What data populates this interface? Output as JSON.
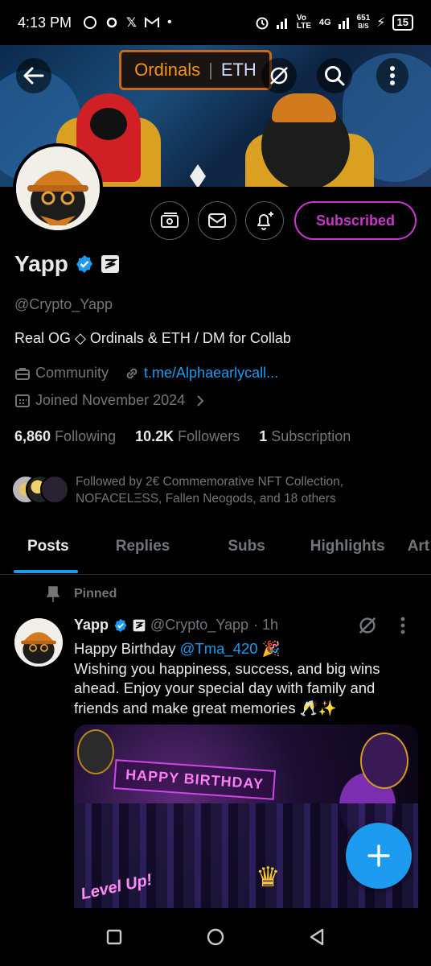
{
  "status_bar": {
    "time": "4:13 PM",
    "network": "Vo LTE",
    "network2": "4G",
    "speed": "651",
    "speed_unit": "B/S",
    "battery": "15"
  },
  "banner": {
    "sign_left": "Ordinals",
    "sign_right": "ETH"
  },
  "profile": {
    "name": "Yapp",
    "handle": "@Crypto_Yapp",
    "bio": "Real OG ◇ Ordinals & ETH / DM for Collab",
    "category": "Community",
    "link": "t.me/Alphaearlycall...",
    "joined": "Joined November 2024",
    "subscribed_label": "Subscribed"
  },
  "stats": {
    "following_count": "6,860",
    "following_label": "Following",
    "followers_count": "10.2K",
    "followers_label": "Followers",
    "subscriptions_count": "1",
    "subscriptions_label": "Subscription"
  },
  "followed_by": "Followed by 2€ Commemorative NFT Collection, NOFACELΞSS, Fallen Neogods, and 18 others",
  "tabs": [
    "Posts",
    "Replies",
    "Subs",
    "Highlights",
    "Art"
  ],
  "pinned_post": {
    "pinned_label": "Pinned",
    "name": "Yapp",
    "handle": "@Crypto_Yapp",
    "time": "· 1h",
    "line1_prefix": "Happy Birthday ",
    "mention": "@Tma_420",
    "line1_suffix": " 🎉",
    "body": "Wishing you happiness, success, and big wins ahead. Enjoy your special day with family and friends and make great memories 🥂✨",
    "media_text": "HAPPY BIRTHDAY",
    "media_text2": "Level Up!"
  },
  "colors": {
    "accent": "#1d9bf0",
    "subscribed": "#c936cc",
    "muted": "#71767b"
  }
}
